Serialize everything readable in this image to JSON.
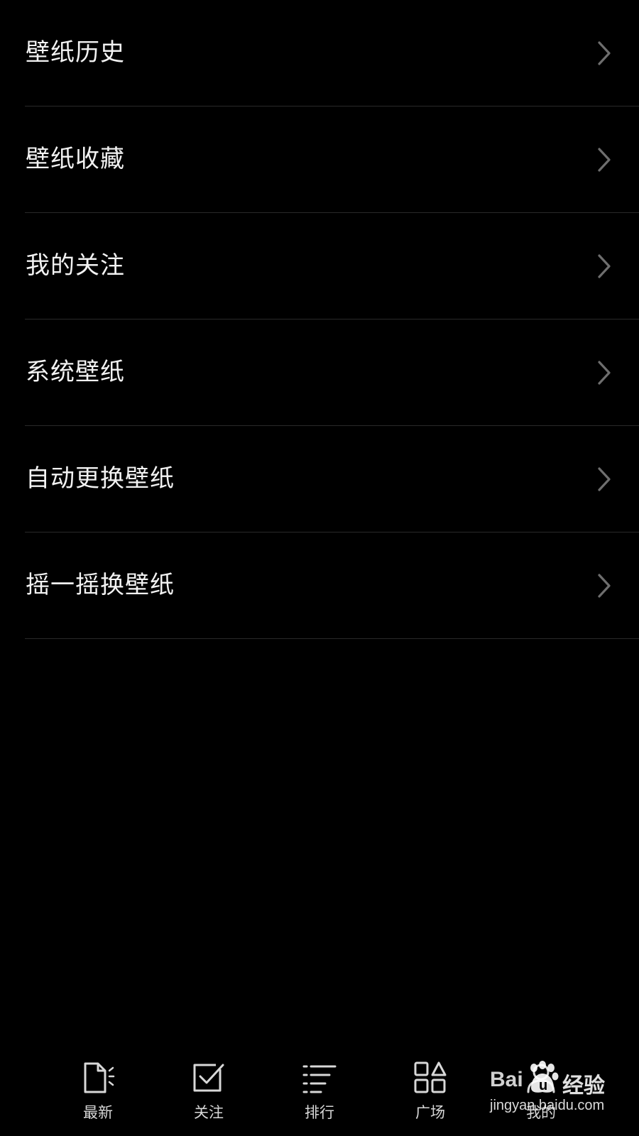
{
  "menu": {
    "items": [
      {
        "label": "壁纸历史",
        "icon": "chevron-right-icon"
      },
      {
        "label": "壁纸收藏",
        "icon": "chevron-right-icon"
      },
      {
        "label": "我的关注",
        "icon": "chevron-right-icon"
      },
      {
        "label": "系统壁纸",
        "icon": "chevron-right-icon"
      },
      {
        "label": "自动更换壁纸",
        "icon": "chevron-right-icon"
      },
      {
        "label": "摇一摇换壁纸",
        "icon": "chevron-right-icon"
      }
    ]
  },
  "bottom_nav": {
    "tabs": [
      {
        "label": "最新",
        "icon": "new-document-icon"
      },
      {
        "label": "关注",
        "icon": "checkbox-icon"
      },
      {
        "label": "排行",
        "icon": "ranking-list-icon"
      },
      {
        "label": "广场",
        "icon": "square-shapes-icon"
      },
      {
        "label": "我的",
        "icon": "profile-icon"
      }
    ]
  },
  "watermark": {
    "brand": "Bai",
    "brand_suffix": "经验",
    "url": "jingyan.baidu.com"
  },
  "colors": {
    "background": "#000000",
    "text": "#f2f2f2",
    "divider": "#2a2a2a",
    "chevron": "#6e6e6e",
    "nav_icon": "#d8d8d8"
  }
}
